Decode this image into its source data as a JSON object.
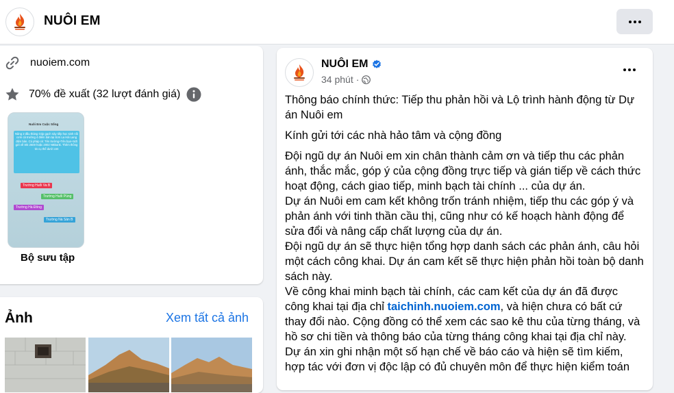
{
  "header": {
    "title": "NUÔI EM",
    "avatar_icon": "campfire-logo-icon",
    "more_icon": "more-dots-icon"
  },
  "intro": {
    "website": "nuoiem.com",
    "website_icon": "link-icon",
    "rating": "70% đề xuất (32 lượt đánh giá)",
    "rating_icon": "star-icon",
    "info_icon": "info-icon",
    "collection_label": "Bộ sưu tập",
    "collection_preview": {
      "top_label": "Nuôi Em Cuộc Sống",
      "text": "Nâng 2 đầu tháng Góp gạch này tiếp học sinh nồi cơm cả trường 4 điểm bản tại Sơn La Hải Lang điện bản. Cú pháp ck: Tên trường+Tên bạn+Sđt gửi về Stk 2500 hoặc 2002 NBbank. Thêm thông tin cụ thể dưới cmt",
      "tags": [
        "Trường Huổi Va B",
        "Trường Huổi Púng",
        "Trường Hà Đông",
        "Trường Nà Sản B"
      ]
    }
  },
  "photos": {
    "title": "Ảnh",
    "see_all": "Xem tất cả ảnh"
  },
  "post": {
    "author": "NUÔI EM",
    "verified_icon": "verified-badge-icon",
    "time": "34 phút",
    "separator": "·",
    "privacy_icon": "globe-icon",
    "more_icon": "more-dots-icon",
    "title_line": "Thông báo chính thức: Tiếp thu phản hồi và Lộ trình hành động từ Dự án Nuôi em",
    "greeting": "Kính gửi tới các nhà hảo tâm và cộng đồng",
    "para1": "Đội ngũ dự án Nuôi em xin chân thành cảm ơn và tiếp thu các phản ánh, thắc mắc, góp ý của cộng đồng trực tiếp và gián tiếp về cách thức hoạt động, cách giao tiếp, minh bạch tài chính ... của dự án.",
    "para2": "Dự án Nuôi em cam kết không trốn tránh nhiệm, tiếp thu các góp ý và phản ánh với tinh thần cầu thị, cũng như có kế hoạch hành động để sửa đổi và nâng cấp chất lượng của dự án.",
    "para3": "Đội ngũ dự án sẽ thực hiện tổng hợp danh sách các phản ánh, câu hỏi một cách công khai. Dự án cam kết sẽ thực hiện phản hồi toàn bộ danh sách này.",
    "para4_before": "Về công khai minh bạch tài chính, các cam kết của dự án đã được công khai tại địa chỉ ",
    "para4_link": "taichinh.nuoiem.com",
    "para4_after": ", và hiện chưa có bất cứ thay đổi nào. Cộng đồng có thể xem các sao kê thu của từng tháng, và hồ sơ chi tiền và thông báo của từng tháng công khai tại địa chỉ này.",
    "para5": "Dự án xin ghi nhận một số hạn chế về báo cáo và hiện sẽ tìm kiếm, hợp tác với đơn vị độc lập có đủ chuyên môn để thực hiện kiểm toán"
  }
}
